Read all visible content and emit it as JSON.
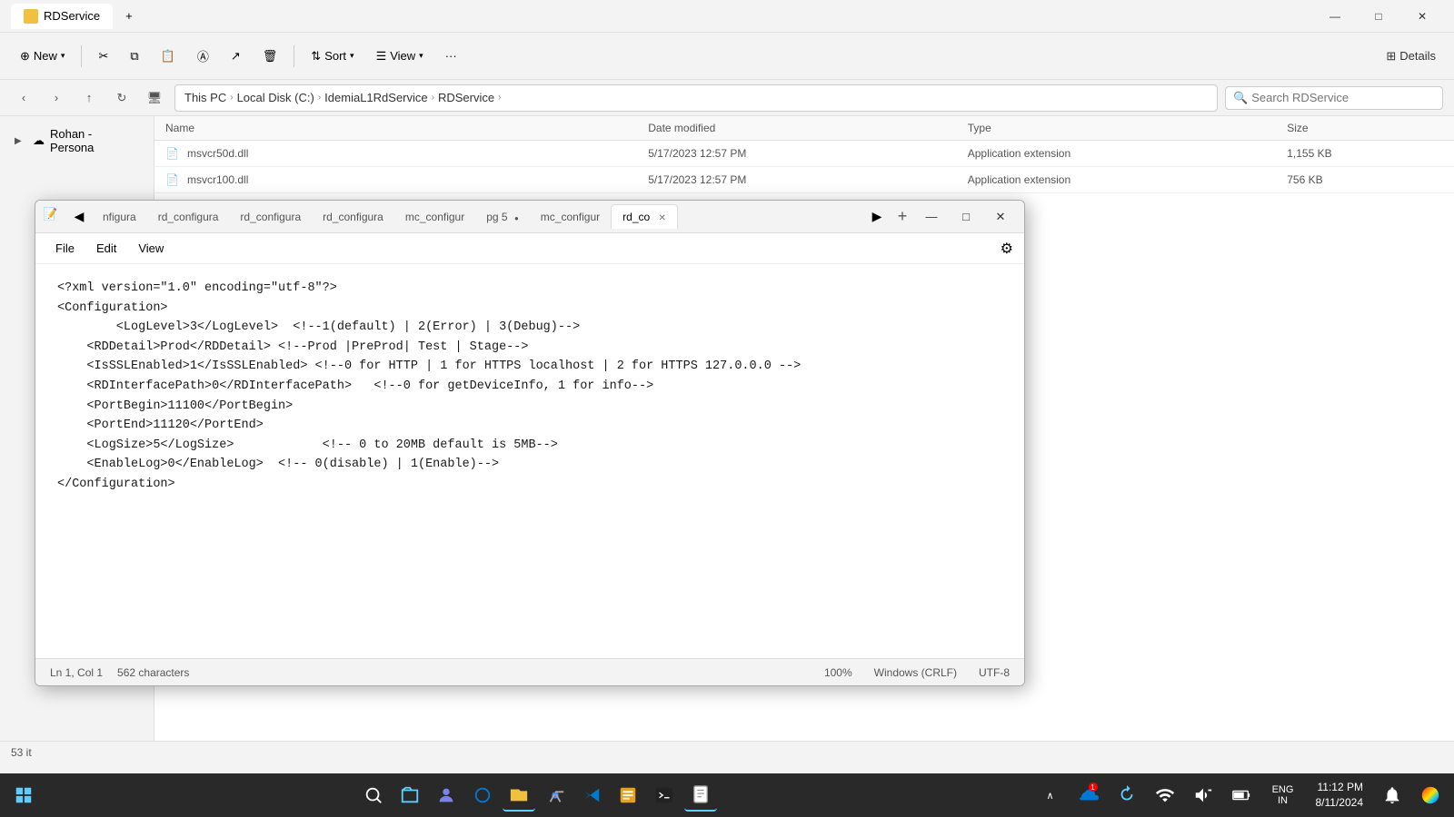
{
  "window": {
    "title": "RDService",
    "tab_close": "×",
    "add_tab": "+",
    "min": "—",
    "max": "□",
    "close": "✕"
  },
  "toolbar": {
    "new_label": "New",
    "cut_label": "",
    "copy_label": "",
    "paste_label": "",
    "rename_label": "",
    "share_label": "",
    "delete_label": "",
    "sort_label": "Sort",
    "view_label": "View",
    "more_label": "···",
    "details_label": "Details"
  },
  "address": {
    "this_pc": "This PC",
    "local_disk": "Local Disk (C:)",
    "folder1": "IdemiaL1RdService",
    "folder2": "RDService",
    "search_placeholder": "Search RDService"
  },
  "sidebar": {
    "item": "Rohan - Persona"
  },
  "files": {
    "headers": [
      "Name",
      "Date modified",
      "Type",
      "Size"
    ],
    "rows": [
      {
        "name": "msvcr50d.dll",
        "date": "5/17/2023 12:57 PM",
        "type": "Application extension",
        "size": "1,155 KB"
      },
      {
        "name": "msvcr100.dll",
        "date": "5/17/2023 12:57 PM",
        "type": "Application extension",
        "size": "756 KB"
      }
    ]
  },
  "notepad": {
    "icon": "📝",
    "tabs": [
      {
        "label": "nfigura",
        "active": false,
        "unsaved": false
      },
      {
        "label": "rd_configura",
        "active": false,
        "unsaved": false
      },
      {
        "label": "rd_configura",
        "active": false,
        "unsaved": false
      },
      {
        "label": "rd_configura",
        "active": false,
        "unsaved": false
      },
      {
        "label": "mc_configur",
        "active": false,
        "unsaved": false
      },
      {
        "label": "pg 5",
        "active": false,
        "unsaved": true
      },
      {
        "label": "mc_configur",
        "active": false,
        "unsaved": false
      },
      {
        "label": "rd_co",
        "active": true,
        "unsaved": false
      }
    ],
    "menu": {
      "file": "File",
      "edit": "Edit",
      "view": "View"
    },
    "content": "<?xml version=\"1.0\" encoding=\"utf-8\"?>\n<Configuration>\n        <LogLevel>3</LogLevel>  <!--1(default) | 2(Error) | 3(Debug)-->\n    <RDDetail>Prod</RDDetail> <!--Prod |PreProd| Test | Stage-->\n    <IsSSLEnabled>1</IsSSLEnabled> <!--0 for HTTP | 1 for HTTPS localhost | 2 for HTTPS 127.0.0.0 -->\n    <RDInterfacePath>0</RDInterfacePath>   <!--0 for getDeviceInfo, 1 for info-->\n    <PortBegin>11100</PortBegin>\n    <PortEnd>11120</PortEnd>\n    <LogSize>5</LogSize>            <!-- 0 to 20MB default is 5MB-->\n    <EnableLog>0</EnableLog>  <!-- 0(disable) | 1(Enable)-->\n</Configuration>",
    "status": {
      "position": "Ln 1, Col 1",
      "chars": "562 characters",
      "zoom": "100%",
      "eol": "Windows (CRLF)",
      "encoding": "UTF-8"
    }
  },
  "taskbar": {
    "time": "11:12 PM",
    "date": "8/11/2024",
    "lang": "ENG",
    "region": "IN"
  },
  "status_bar": {
    "items_count": "53 it"
  }
}
